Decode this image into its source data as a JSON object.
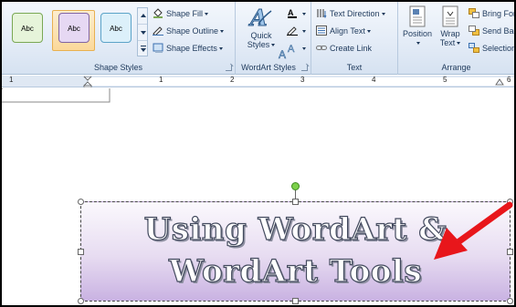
{
  "ribbon": {
    "shape_styles": {
      "swatches": [
        {
          "label": "Abc",
          "fill": "#e6f4da",
          "border": "#7aa854"
        },
        {
          "label": "Abc",
          "fill": "#e6d8f3",
          "border": "#8064a2"
        },
        {
          "label": "Abc",
          "fill": "#dcf0fa",
          "border": "#5ba3c8"
        }
      ],
      "shape_fill": "Shape Fill",
      "shape_outline": "Shape Outline",
      "shape_effects": "Shape Effects",
      "group_label": "Shape Styles"
    },
    "wordart_styles": {
      "quick_styles_line1": "Quick",
      "quick_styles_line2": "Styles",
      "group_label": "WordArt Styles"
    },
    "text": {
      "text_direction": "Text Direction",
      "align_text": "Align Text",
      "create_link": "Create Link",
      "group_label": "Text"
    },
    "arrange": {
      "position": "Position",
      "wrap_text_line1": "Wrap",
      "wrap_text_line2": "Text",
      "bring_forward": "Bring For",
      "send_backward": "Send Bac",
      "selection_pane": "Selection",
      "group_label": "Arrange"
    }
  },
  "ruler": {
    "numbers": [
      "1",
      "1",
      "2",
      "3",
      "4",
      "5",
      "6"
    ]
  },
  "wordart": {
    "line1": "Using WordArt &",
    "line2": "WordArt Tools"
  },
  "colors": {
    "arrow": "#e8161b",
    "rotate_handle": "#7cd04a"
  }
}
